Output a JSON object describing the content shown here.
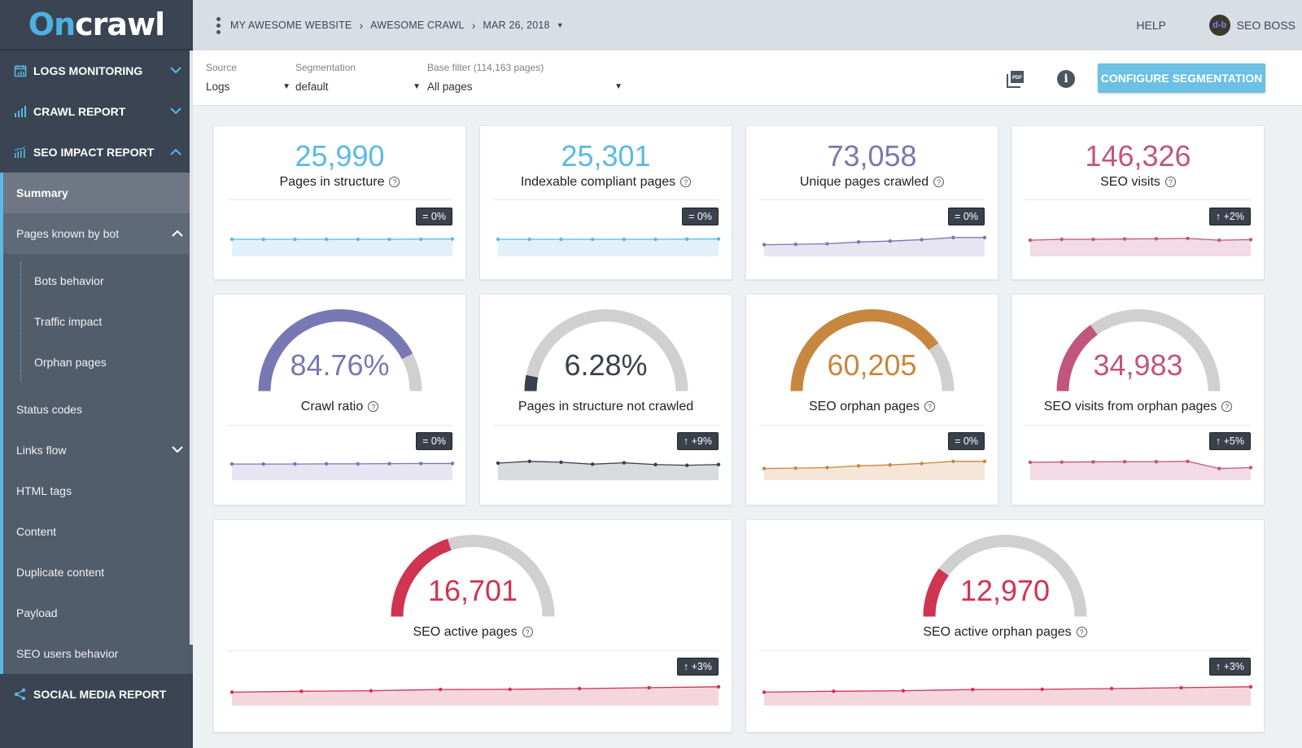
{
  "app": {
    "logo_on": "On",
    "logo_crawl": "crawl"
  },
  "topbar": {
    "breadcrumbs": [
      "MY AWESOME WEBSITE",
      "AWESOME CRAWL",
      "MAR 26, 2018"
    ],
    "help_label": "HELP",
    "user_name": "SEO BOSS",
    "avatar_text": "d-b"
  },
  "filters": {
    "source": {
      "label": "Source",
      "value": "Logs"
    },
    "segmentation": {
      "label": "Segmentation",
      "value": "default"
    },
    "base_filter": {
      "label": "Base filter (114,163 pages)",
      "value": "All pages"
    },
    "configure_button": "CONFIGURE SEGMENTATION",
    "pdf_label": "PDF",
    "info_label": "i"
  },
  "sidebar": {
    "sections": [
      {
        "label": "LOGS MONITORING",
        "icon": "calendar-chart-icon",
        "expanded": false
      },
      {
        "label": "CRAWL REPORT",
        "icon": "bar-chart-icon",
        "expanded": false
      },
      {
        "label": "SEO IMPACT REPORT",
        "icon": "trend-bars-icon",
        "expanded": true
      }
    ],
    "seo_items": [
      {
        "label": "Summary",
        "active": true
      },
      {
        "label": "Pages known by bot",
        "expanded": true
      },
      {
        "label": "Status codes"
      },
      {
        "label": "Links flow",
        "has_children": true
      },
      {
        "label": "HTML tags"
      },
      {
        "label": "Content"
      },
      {
        "label": "Duplicate content"
      },
      {
        "label": "Payload"
      },
      {
        "label": "SEO users behavior"
      }
    ],
    "nested_items": [
      "Bots behavior",
      "Traffic impact",
      "Orphan pages"
    ],
    "bottom_section": {
      "label": "SOCIAL MEDIA REPORT",
      "icon": "share-icon"
    }
  },
  "colors": {
    "blue": "#5bb9e4",
    "purple": "#7878b4",
    "pink": "#c0567e",
    "orange": "#c8873f",
    "red": "#cf3451",
    "dark": "#39414d",
    "gauge_bg": "#d0d0d0"
  },
  "cards": [
    {
      "value": "25,990",
      "title": "Pages in structure",
      "help": true,
      "badge": "= 0%",
      "color": "#5bb9e4",
      "fill": "#e2f1f9",
      "trend": [
        0.5,
        0.5,
        0.5,
        0.5,
        0.5,
        0.5,
        0.51,
        0.52
      ]
    },
    {
      "value": "25,301",
      "title": "Indexable compliant pages",
      "help": true,
      "badge": "= 0%",
      "color": "#5bb9e4",
      "fill": "#e2f1f9",
      "trend": [
        0.5,
        0.5,
        0.5,
        0.5,
        0.5,
        0.5,
        0.51,
        0.52
      ]
    },
    {
      "value": "73,058",
      "title": "Unique pages crawled",
      "help": true,
      "badge": "= 0%",
      "color": "#7878b4",
      "fill": "#e6e5f1",
      "trend": [
        0.2,
        0.22,
        0.25,
        0.35,
        0.4,
        0.48,
        0.6,
        0.6
      ]
    },
    {
      "value": "146,326",
      "title": "SEO visits",
      "help": true,
      "badge": "↑ +2%",
      "color": "#c0567e",
      "fill": "#f2dbe5",
      "trend": [
        0.45,
        0.5,
        0.5,
        0.52,
        0.53,
        0.55,
        0.45,
        0.48
      ]
    },
    {
      "value": "84.76%",
      "title": "Crawl ratio",
      "help": true,
      "badge": "= 0%",
      "color": "#7878b4",
      "fill": "#e6e5f1",
      "gauge": 0.8476,
      "trend": [
        0.45,
        0.45,
        0.45,
        0.46,
        0.46,
        0.47,
        0.48,
        0.48
      ]
    },
    {
      "value": "6.28%",
      "title": "Pages in structure not crawled",
      "help": false,
      "badge": "↑ +9%",
      "color": "#39414d",
      "fill": "#d9dadd",
      "gauge": 0.0628,
      "trend": [
        0.5,
        0.6,
        0.55,
        0.44,
        0.52,
        0.42,
        0.38,
        0.42
      ]
    },
    {
      "value": "60,205",
      "title": "SEO orphan pages",
      "help": true,
      "badge": "= 0%",
      "color": "#c8873f",
      "fill": "#f5e6d8",
      "gauge": 0.8,
      "trend": [
        0.2,
        0.22,
        0.25,
        0.35,
        0.4,
        0.48,
        0.6,
        0.6
      ]
    },
    {
      "value": "34,983",
      "title": "SEO visits from orphan pages",
      "help": true,
      "badge": "↑ +5%",
      "color": "#c0567e",
      "fill": "#f2dbe5",
      "gauge": 0.3,
      "trend": [
        0.55,
        0.56,
        0.57,
        0.58,
        0.58,
        0.6,
        0.2,
        0.25
      ]
    },
    {
      "value": "16,701",
      "title": "SEO active pages",
      "help": true,
      "badge": "↑ +3%",
      "color": "#cf3451",
      "fill": "#f5d6dd",
      "gauge": 0.4,
      "trend": [
        0.3,
        0.35,
        0.38,
        0.45,
        0.46,
        0.5,
        0.55,
        0.6
      ]
    },
    {
      "value": "12,970",
      "title": "SEO active orphan pages",
      "help": true,
      "badge": "↑ +3%",
      "color": "#cf3451",
      "fill": "#f5d6dd",
      "gauge": 0.2,
      "trend": [
        0.3,
        0.35,
        0.38,
        0.45,
        0.46,
        0.5,
        0.55,
        0.6
      ]
    }
  ]
}
